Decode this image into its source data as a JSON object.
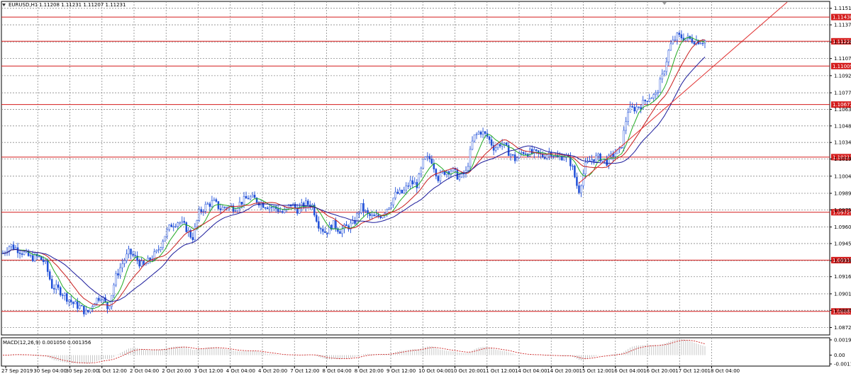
{
  "header": {
    "symbol": "EURUSD,H1",
    "ohlc": "1.11208 1.11231 1.11207 1.11231"
  },
  "macd": {
    "label": "MACD(12,26,9) 0.001050 0.001356",
    "axis_labels": [
      "0.001975",
      "0.00",
      "-0.00114"
    ],
    "axis_values": [
      0.001975,
      0.0,
      -0.00114
    ]
  },
  "price_axis": {
    "labels": [
      "1.11515",
      "1.11370",
      "1.11220",
      "1.11075",
      "1.10925",
      "1.10775",
      "1.10630",
      "1.10485",
      "1.10340",
      "1.10195",
      "1.10045",
      "1.09895",
      "1.09750",
      "1.09600",
      "1.09455",
      "1.09305",
      "1.09165",
      "1.09015",
      "1.08870",
      "1.08720"
    ],
    "values": [
      1.11515,
      1.1137,
      1.1122,
      1.11075,
      1.10925,
      1.10775,
      1.1063,
      1.10485,
      1.1034,
      1.10195,
      1.10045,
      1.09895,
      1.0975,
      1.096,
      1.09455,
      1.09305,
      1.09165,
      1.09015,
      1.0887,
      1.0872
    ]
  },
  "levels": [
    {
      "label": "1.11438",
      "value": 1.11438
    },
    {
      "label": "1.11226",
      "value": 1.11226
    },
    {
      "label": "1.11009",
      "value": 1.11009
    },
    {
      "label": "1.10672",
      "value": 1.10672
    },
    {
      "label": "1.10212",
      "value": 1.10212
    },
    {
      "label": "1.09729",
      "value": 1.09729
    },
    {
      "label": "1.09310",
      "value": 1.0931
    },
    {
      "label": "1.08861",
      "value": 1.08861
    }
  ],
  "time_axis": [
    "27 Sep 2019",
    "30 Sep 04:00",
    "30 Sep 20:00",
    "1 Oct 12:00",
    "2 Oct 04:00",
    "2 Oct 20:00",
    "3 Oct 12:00",
    "4 Oct 04:00",
    "4 Oct 20:00",
    "7 Oct 12:00",
    "8 Oct 04:00",
    "8 Oct 20:00",
    "9 Oct 12:00",
    "10 Oct 04:00",
    "10 Oct 20:00",
    "11 Oct 12:00",
    "14 Oct 04:00",
    "14 Oct 20:00",
    "15 Oct 12:00",
    "16 Oct 04:00",
    "16 Oct 20:00",
    "17 Oct 12:00",
    "18 Oct 04:00"
  ],
  "colors": {
    "candles": "#1f4fd8",
    "level_line": "#d41c1c",
    "level_tag": "#d41c1c",
    "ma_fast": "#22aa22",
    "ma_mid": "#c81e1e",
    "ma_slow": "#1c1c9c",
    "trend": "#e03030",
    "macd_hist": "#b9b9b9",
    "macd_signal": "#cc2222",
    "grid": "#8a8a8a"
  },
  "chart_data": {
    "type": "line",
    "title": "",
    "xlabel": "",
    "ylabel": "",
    "ylim": [
      1.0866,
      1.1158
    ],
    "x": [
      0,
      10,
      20,
      30,
      40,
      50,
      60,
      70,
      80,
      90,
      100,
      110,
      120,
      130,
      140,
      150,
      160,
      170,
      180,
      190,
      200,
      210,
      220,
      230,
      240,
      250,
      260,
      270,
      280,
      290,
      300,
      310,
      320,
      330,
      340,
      350,
      360,
      370,
      380,
      390,
      400,
      410,
      420,
      430,
      440,
      450,
      460,
      470,
      480,
      490,
      500,
      510,
      520,
      530,
      540,
      550,
      560,
      570,
      580,
      590,
      600,
      610,
      620,
      630,
      640,
      650,
      660,
      670,
      680,
      690,
      700,
      710,
      720,
      730,
      740,
      750,
      760,
      770,
      780,
      790,
      800,
      810,
      820,
      830,
      840,
      850,
      860,
      870,
      880,
      890,
      900,
      910,
      920,
      930,
      940,
      950,
      960,
      970,
      980,
      990,
      1000
    ],
    "series": [
      {
        "values": [
          1.0937,
          1.0944,
          1.0941,
          1.0937,
          1.0933,
          1.0934,
          1.0929,
          1.0908,
          1.0905,
          1.0899,
          1.0893,
          1.089,
          1.0884,
          1.0895,
          1.09,
          1.0888,
          1.0915,
          1.0928,
          1.0938,
          1.0932,
          1.0925,
          1.0932,
          1.0938,
          1.0952,
          1.0962,
          1.0965,
          1.096,
          1.095,
          1.0973,
          1.0979,
          1.0982,
          1.0976,
          1.0978,
          1.0977,
          1.0982,
          1.0986,
          1.0984,
          1.098,
          1.0978,
          1.0976,
          1.0972,
          1.098,
          1.0975,
          1.098,
          1.098,
          1.0962,
          1.0955,
          1.0963,
          1.0957,
          1.096,
          1.0963,
          1.0978,
          1.097,
          1.0968,
          1.0971,
          1.0979,
          1.0989,
          1.099,
          1.0999,
          1.0997,
          1.1019,
          1.102,
          1.1003,
          1.1009,
          1.101,
          1.1003,
          1.1008,
          1.1038,
          1.1044,
          1.1039,
          1.1029,
          1.1034,
          1.1026,
          1.1019,
          1.1026,
          1.1025,
          1.1024,
          1.1022,
          1.1026,
          1.102,
          1.1023,
          1.1015,
          1.0991,
          1.1014,
          1.102,
          1.1021,
          1.1017,
          1.1024,
          1.1027,
          1.1062,
          1.1064,
          1.1067,
          1.1074,
          1.1075,
          1.1093,
          1.1118,
          1.1127,
          1.1126,
          1.1124,
          1.1123,
          1.1123
        ]
      }
    ]
  }
}
